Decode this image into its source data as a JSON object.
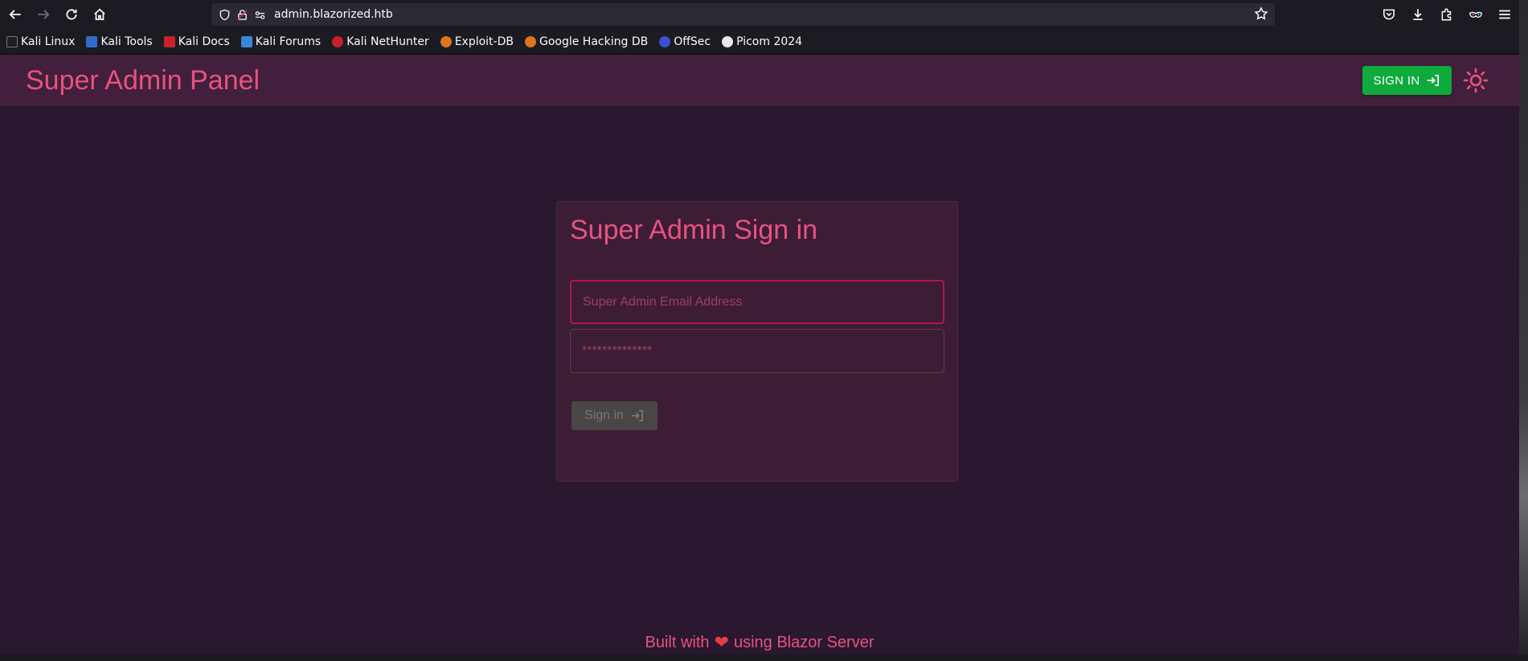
{
  "browser": {
    "url": "admin.blazorized.htb",
    "bookmarks": [
      {
        "label": "Kali Linux",
        "color": "#1e1e24"
      },
      {
        "label": "Kali Tools",
        "color": "#2f6cc9"
      },
      {
        "label": "Kali Docs",
        "color": "#c8202d"
      },
      {
        "label": "Kali Forums",
        "color": "#3a86d6"
      },
      {
        "label": "Kali NetHunter",
        "color": "#c8202d"
      },
      {
        "label": "Exploit-DB",
        "color": "#e0731e"
      },
      {
        "label": "Google Hacking DB",
        "color": "#e0731e"
      },
      {
        "label": "OffSec",
        "color": "#3c4fd0"
      },
      {
        "label": "Picom 2024",
        "color": "#e8e8e8"
      }
    ]
  },
  "app": {
    "title": "Super Admin Panel",
    "signin_label": "SIGN IN",
    "accent": "#e8527e",
    "signin_color": "#0eab3c"
  },
  "card": {
    "title": "Super Admin Sign in",
    "email_placeholder": "Super Admin Email Address",
    "password_placeholder": "**************",
    "button_label": "Sign in"
  },
  "footer": {
    "before": "Built with",
    "after": "using Blazor Server"
  }
}
